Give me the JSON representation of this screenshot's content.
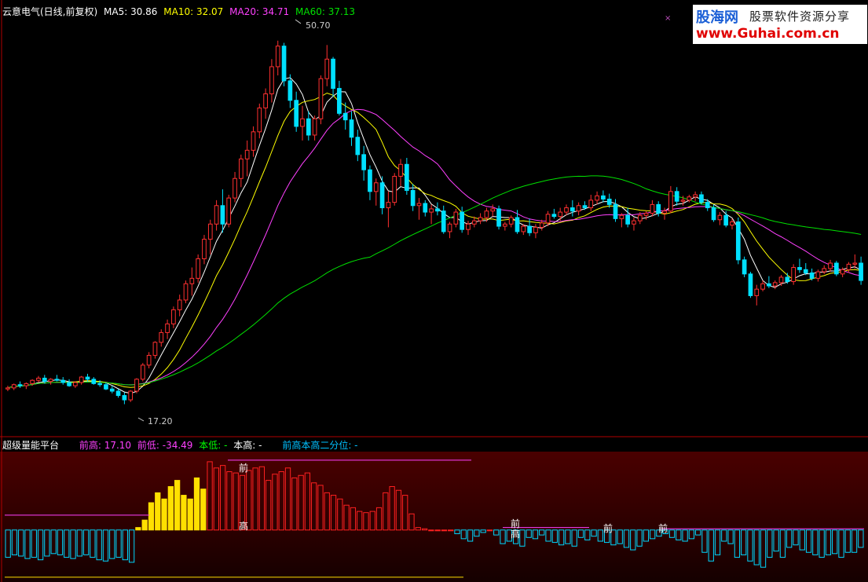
{
  "title": "云意电气(日线,前复权)",
  "ma_legend": [
    {
      "label": "MA5: 30.86",
      "color": "#ffffff"
    },
    {
      "label": "MA10: 32.07",
      "color": "#ffff00"
    },
    {
      "label": "MA20: 34.71",
      "color": "#ff40ff"
    },
    {
      "label": "MA60: 37.13",
      "color": "#00e000"
    }
  ],
  "indicator_legend": {
    "name": "超级量能平台",
    "items": [
      {
        "label": "前高: 17.10",
        "color": "#ff40ff"
      },
      {
        "label": "前低: -34.49",
        "color": "#ff40ff"
      },
      {
        "label": "本低: -",
        "color": "#00ff00"
      },
      {
        "label": "本高: -",
        "color": "#ffffff"
      },
      {
        "label": "前高本高二分位: -",
        "color": "#00c0ff"
      }
    ]
  },
  "annotations": {
    "high_price": "50.70",
    "low_price": "17.20",
    "qian": "前",
    "gao": "高",
    "x_mark": "×"
  },
  "logo": {
    "line1a": "股海网",
    "line1b": "股票软件资源分享",
    "line2": "www.Guhai.com.cn"
  },
  "chart_data": {
    "type": "candlestick",
    "ylim": [
      15,
      53
    ],
    "colors": {
      "up": "#ff3030",
      "down": "#00e0ff"
    },
    "candles": [
      [
        18.6,
        18.9,
        18.4,
        18.7
      ],
      [
        18.7,
        19.1,
        18.5,
        19.0
      ],
      [
        19.0,
        19.3,
        18.7,
        18.9
      ],
      [
        18.9,
        19.2,
        18.6,
        19.1
      ],
      [
        19.1,
        19.5,
        18.9,
        19.4
      ],
      [
        19.4,
        19.8,
        19.2,
        19.6
      ],
      [
        19.6,
        19.9,
        19.1,
        19.3
      ],
      [
        19.3,
        19.6,
        19.0,
        19.5
      ],
      [
        19.5,
        19.9,
        19.3,
        19.4
      ],
      [
        19.4,
        19.7,
        19.0,
        19.2
      ],
      [
        19.2,
        19.5,
        18.8,
        18.9
      ],
      [
        18.9,
        19.3,
        18.7,
        19.2
      ],
      [
        19.2,
        19.8,
        19.0,
        19.7
      ],
      [
        19.7,
        20.0,
        19.3,
        19.5
      ],
      [
        19.5,
        19.7,
        19.0,
        19.1
      ],
      [
        19.1,
        19.4,
        18.8,
        19.0
      ],
      [
        19.0,
        19.2,
        18.5,
        18.6
      ],
      [
        18.6,
        18.9,
        18.2,
        18.4
      ],
      [
        18.4,
        18.6,
        17.8,
        18.0
      ],
      [
        18.0,
        18.3,
        17.2,
        17.6
      ],
      [
        17.6,
        18.5,
        17.4,
        18.4
      ],
      [
        18.4,
        19.6,
        18.2,
        19.5
      ],
      [
        19.5,
        21.0,
        19.3,
        20.8
      ],
      [
        20.8,
        22.0,
        20.5,
        21.7
      ],
      [
        21.7,
        23.0,
        21.4,
        22.9
      ],
      [
        22.9,
        24.1,
        22.5,
        23.8
      ],
      [
        23.8,
        25.0,
        23.2,
        24.6
      ],
      [
        24.6,
        26.2,
        24.2,
        25.9
      ],
      [
        25.9,
        27.3,
        25.3,
        26.8
      ],
      [
        26.8,
        28.6,
        26.5,
        28.3
      ],
      [
        28.3,
        29.8,
        27.2,
        28.8
      ],
      [
        28.8,
        31.0,
        28.4,
        30.6
      ],
      [
        30.6,
        32.8,
        30.1,
        32.4
      ],
      [
        32.4,
        34.2,
        31.0,
        33.8
      ],
      [
        33.8,
        36.0,
        33.2,
        35.5
      ],
      [
        35.5,
        37.0,
        33.0,
        33.8
      ],
      [
        33.8,
        36.5,
        33.5,
        36.2
      ],
      [
        36.2,
        38.6,
        35.8,
        38.0
      ],
      [
        38.0,
        40.2,
        37.2,
        39.8
      ],
      [
        39.8,
        41.5,
        38.2,
        40.6
      ],
      [
        40.6,
        42.8,
        40.0,
        42.3
      ],
      [
        42.3,
        44.9,
        41.7,
        44.5
      ],
      [
        44.5,
        46.3,
        43.5,
        45.8
      ],
      [
        45.8,
        49.0,
        45.0,
        48.3
      ],
      [
        48.3,
        50.7,
        47.5,
        50.2
      ],
      [
        50.2,
        50.5,
        46.5,
        47.0
      ],
      [
        47.0,
        47.6,
        44.5,
        45.2
      ],
      [
        45.2,
        46.0,
        42.3,
        42.8
      ],
      [
        42.8,
        44.7,
        41.5,
        43.5
      ],
      [
        43.5,
        44.2,
        41.5,
        42.0
      ],
      [
        42.0,
        43.8,
        41.5,
        43.5
      ],
      [
        43.5,
        47.5,
        43.0,
        47.2
      ],
      [
        47.2,
        50.3,
        46.5,
        49.0
      ],
      [
        49.0,
        49.2,
        45.5,
        46.3
      ],
      [
        46.3,
        47.0,
        43.8,
        44.0
      ],
      [
        44.0,
        45.0,
        42.5,
        43.4
      ],
      [
        43.4,
        44.2,
        41.0,
        41.8
      ],
      [
        41.8,
        42.5,
        39.6,
        40.2
      ],
      [
        40.2,
        41.0,
        37.8,
        38.8
      ],
      [
        38.8,
        39.2,
        36.0,
        36.8
      ],
      [
        36.8,
        38.0,
        35.5,
        37.6
      ],
      [
        37.6,
        38.2,
        34.7,
        35.3
      ],
      [
        35.3,
        36.8,
        33.5,
        35.8
      ],
      [
        35.8,
        38.5,
        35.5,
        38.2
      ],
      [
        38.2,
        39.8,
        37.3,
        39.3
      ],
      [
        39.3,
        39.9,
        36.5,
        36.9
      ],
      [
        36.9,
        37.5,
        35.0,
        35.5
      ],
      [
        35.5,
        36.2,
        34.2,
        35.7
      ],
      [
        35.7,
        36.0,
        34.5,
        34.9
      ],
      [
        34.9,
        35.6,
        33.8,
        35.2
      ],
      [
        35.2,
        35.8,
        34.6,
        35.0
      ],
      [
        35.0,
        35.5,
        32.9,
        33.1
      ],
      [
        33.1,
        34.0,
        32.5,
        33.8
      ],
      [
        33.8,
        35.2,
        33.5,
        34.9
      ],
      [
        34.9,
        35.4,
        33.0,
        33.3
      ],
      [
        33.3,
        34.1,
        32.8,
        33.8
      ],
      [
        33.8,
        34.5,
        33.5,
        34.1
      ],
      [
        34.1,
        34.8,
        33.8,
        34.4
      ],
      [
        34.4,
        35.3,
        34.0,
        35.0
      ],
      [
        35.0,
        35.6,
        34.5,
        35.2
      ],
      [
        35.2,
        35.5,
        33.3,
        33.6
      ],
      [
        33.6,
        34.0,
        33.2,
        33.8
      ],
      [
        33.8,
        34.6,
        33.5,
        34.4
      ],
      [
        34.4,
        35.1,
        32.9,
        33.1
      ],
      [
        33.1,
        33.8,
        32.8,
        33.6
      ],
      [
        33.6,
        34.3,
        32.7,
        33.0
      ],
      [
        33.0,
        33.8,
        32.5,
        33.5
      ],
      [
        33.5,
        34.2,
        33.2,
        33.9
      ],
      [
        33.9,
        35.0,
        33.6,
        34.7
      ],
      [
        34.7,
        35.2,
        34.3,
        34.5
      ],
      [
        34.5,
        35.3,
        34.1,
        34.9
      ],
      [
        34.9,
        35.6,
        34.6,
        35.3
      ],
      [
        35.3,
        36.0,
        34.5,
        35.0
      ],
      [
        35.0,
        35.8,
        34.6,
        35.5
      ],
      [
        35.5,
        35.9,
        35.1,
        35.3
      ],
      [
        35.3,
        36.5,
        35.0,
        36.0
      ],
      [
        36.0,
        36.8,
        35.6,
        36.4
      ],
      [
        36.4,
        36.9,
        35.8,
        36.1
      ],
      [
        36.1,
        36.6,
        35.3,
        35.6
      ],
      [
        35.6,
        36.1,
        34.0,
        34.3
      ],
      [
        34.3,
        34.8,
        33.5,
        34.6
      ],
      [
        34.6,
        35.3,
        33.5,
        33.8
      ],
      [
        33.8,
        34.4,
        33.2,
        34.1
      ],
      [
        34.1,
        34.9,
        33.8,
        34.6
      ],
      [
        34.6,
        35.0,
        34.2,
        34.8
      ],
      [
        34.8,
        36.0,
        34.5,
        35.6
      ],
      [
        35.6,
        35.9,
        34.5,
        34.8
      ],
      [
        34.8,
        35.3,
        34.2,
        35.0
      ],
      [
        35.0,
        37.3,
        34.8,
        36.8
      ],
      [
        36.8,
        37.2,
        35.5,
        35.9
      ],
      [
        35.9,
        36.4,
        35.5,
        36.0
      ],
      [
        36.0,
        36.5,
        35.8,
        36.3
      ],
      [
        36.3,
        36.8,
        35.9,
        36.5
      ],
      [
        36.5,
        36.8,
        35.6,
        35.8
      ],
      [
        35.8,
        36.1,
        35.0,
        35.3
      ],
      [
        35.3,
        35.6,
        34.0,
        34.2
      ],
      [
        34.2,
        34.9,
        33.7,
        34.6
      ],
      [
        34.6,
        35.0,
        33.5,
        33.7
      ],
      [
        33.7,
        34.3,
        33.3,
        34.0
      ],
      [
        34.0,
        34.4,
        30.1,
        30.5
      ],
      [
        30.5,
        30.8,
        28.9,
        29.2
      ],
      [
        29.2,
        29.4,
        27.0,
        27.2
      ],
      [
        27.2,
        28.2,
        26.3,
        27.8
      ],
      [
        27.8,
        28.6,
        27.6,
        28.3
      ],
      [
        28.3,
        29.0,
        27.9,
        28.1
      ],
      [
        28.1,
        28.6,
        27.8,
        28.4
      ],
      [
        28.4,
        29.1,
        28.1,
        28.9
      ],
      [
        28.9,
        29.3,
        28.3,
        28.5
      ],
      [
        28.5,
        30.1,
        28.2,
        29.8
      ],
      [
        29.8,
        30.6,
        29.3,
        29.6
      ],
      [
        29.6,
        30.2,
        29.1,
        29.3
      ],
      [
        29.3,
        29.7,
        28.6,
        28.8
      ],
      [
        28.8,
        29.6,
        28.5,
        29.4
      ],
      [
        29.4,
        30.0,
        29.2,
        29.7
      ],
      [
        29.7,
        30.5,
        29.4,
        30.2
      ],
      [
        30.2,
        30.4,
        29.0,
        29.2
      ],
      [
        29.2,
        29.8,
        28.9,
        29.6
      ],
      [
        29.6,
        30.3,
        29.3,
        30.1
      ],
      [
        30.1,
        31.0,
        29.7,
        30.2
      ],
      [
        30.2,
        30.8,
        28.2,
        28.6
      ]
    ],
    "indicator": {
      "ylim": [
        -40,
        60
      ],
      "values": [
        -22,
        -20,
        -21,
        -23,
        -22,
        -24,
        -21,
        -19,
        -20,
        -22,
        -23,
        -21,
        -20,
        -22,
        -24,
        -25,
        -23,
        -22,
        -24,
        -26,
        2,
        8,
        22,
        30,
        25,
        35,
        40,
        28,
        25,
        42,
        33,
        55,
        50,
        52,
        47,
        46,
        44,
        48,
        50,
        51,
        40,
        45,
        47,
        50,
        42,
        44,
        46,
        38,
        36,
        30,
        28,
        25,
        20,
        18,
        15,
        14,
        15,
        18,
        30,
        35,
        32,
        28,
        13,
        2,
        1
      ],
      "flat": [
        0,
        0,
        0,
        0,
        -3,
        -7,
        -9,
        -5,
        -2,
        0,
        -4,
        -11,
        -9,
        -11,
        -13,
        -6,
        -7,
        -4,
        -9,
        -10,
        -12,
        -11,
        -13,
        -6,
        -8,
        -5,
        -9,
        -10,
        -12,
        -11,
        -14,
        -16,
        -13,
        -9,
        -7,
        -5,
        -3,
        -6,
        -8,
        -9,
        -7,
        -4,
        -18,
        -25,
        -20,
        -9,
        -11,
        -22,
        -20,
        -25,
        -28,
        -30,
        -22,
        -17,
        -22,
        -14,
        -12,
        -16,
        -18,
        -20,
        -22,
        -20,
        -19,
        -22,
        -18,
        -18,
        -14
      ],
      "threshold_upper": 55,
      "threshold_lower": -38,
      "mid_line": 12
    }
  }
}
